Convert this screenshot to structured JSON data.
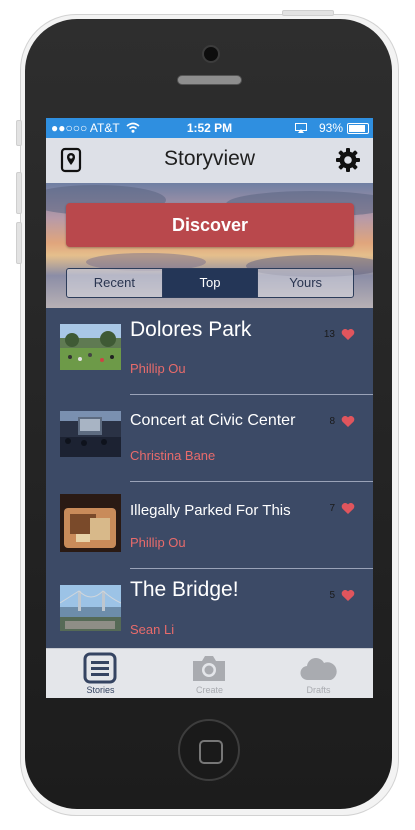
{
  "status_bar": {
    "carrier": "●●○○○ AT&T",
    "time": "1:52 PM",
    "battery": "93%",
    "battery_level": 0.93
  },
  "nav": {
    "title": "Storyview",
    "left_icon": "map-pin-icon",
    "right_icon": "gear-icon"
  },
  "hero": {
    "discover_label": "Discover"
  },
  "segments": [
    {
      "label": "Recent",
      "active": false
    },
    {
      "label": "Top",
      "active": true
    },
    {
      "label": "Yours",
      "active": false
    }
  ],
  "stories": [
    {
      "title": "Dolores Park",
      "author": "Phillip Ou",
      "likes": "13",
      "thumb": "park"
    },
    {
      "title": "Concert at Civic Center",
      "author": "Christina Bane",
      "likes": "8",
      "thumb": "concert"
    },
    {
      "title": "Illegally Parked For This",
      "author": "Phillip Ou",
      "likes": "7",
      "thumb": "food"
    },
    {
      "title": "The Bridge!",
      "author": "Sean Li",
      "likes": "5",
      "thumb": "bridge"
    }
  ],
  "tabbar": [
    {
      "label": "Stories",
      "icon": "list-icon",
      "active": true
    },
    {
      "label": "Create",
      "icon": "camera-icon",
      "active": false
    },
    {
      "label": "Drafts",
      "icon": "cloud-icon",
      "active": false
    }
  ],
  "colors": {
    "accent_red": "#b9484c",
    "list_bg": "#3c4a66",
    "author": "#e86b6b",
    "status_bar": "#2f8fe0"
  }
}
